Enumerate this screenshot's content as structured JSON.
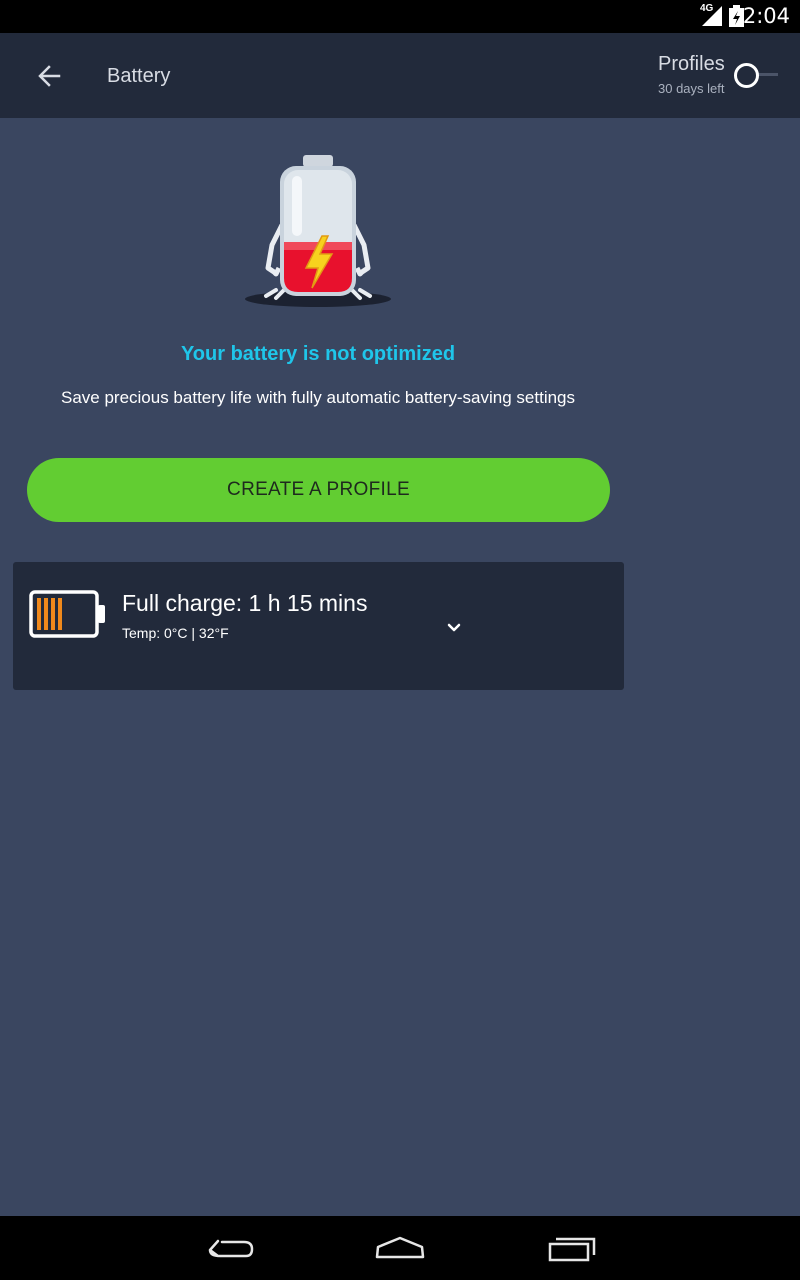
{
  "status_bar": {
    "time": "2:04",
    "network": "4G"
  },
  "header": {
    "title": "Battery",
    "profiles_label": "Profiles",
    "profiles_sub": "30 days left",
    "profiles_toggle_on": false
  },
  "main": {
    "headline": "Your battery is not optimized",
    "subline": "Save precious battery life with fully automatic battery-saving settings",
    "cta_label": "CREATE A PROFILE"
  },
  "battery_card": {
    "title": "Full charge: 1 h 15 mins",
    "temp": "Temp: 0°C | 32°F",
    "charge_bars": 4
  },
  "colors": {
    "accent_cyan": "#1fc6ea",
    "cta_green": "#62cd32",
    "bar_orange": "#f0891c",
    "background": "#3a4660",
    "header_bg": "#222a3b"
  },
  "icons": [
    "back-arrow-icon",
    "toggle-switch",
    "battery-robot-illustration",
    "battery-level-icon",
    "chevron-down-icon",
    "nav-back-icon",
    "nav-home-icon",
    "nav-recents-icon"
  ]
}
